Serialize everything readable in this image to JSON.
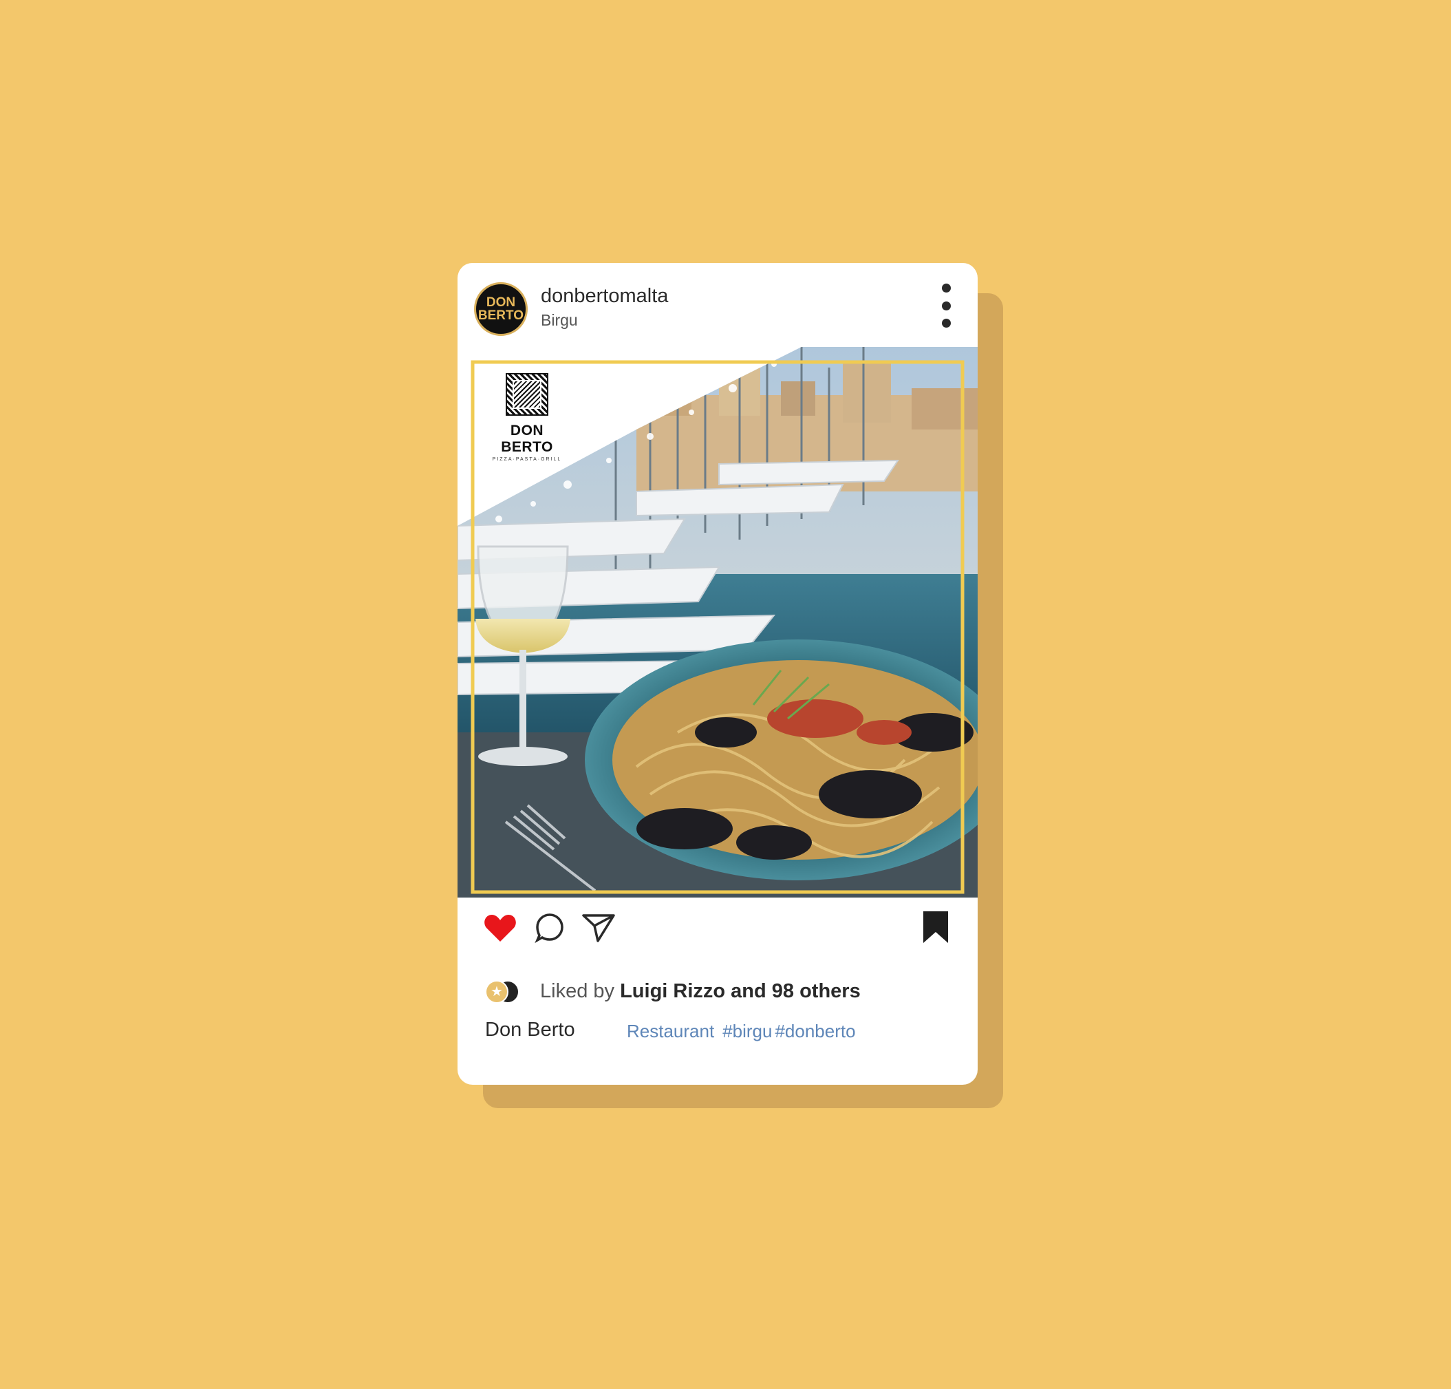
{
  "post": {
    "username": "donbertomalta",
    "location": "Birgu",
    "avatar_text": [
      "DON",
      "BERTO"
    ],
    "brand_overlay": {
      "name": "DON BERTO",
      "tagline": "PIZZA·PASTA·GRILL"
    },
    "liked_by_prefix": "Liked by",
    "liked_by_name": "Luigi Rizzo and 98 others",
    "caption_user": "Don Berto",
    "tags": [
      "Restaurant",
      "#birgu",
      "#donberto"
    ]
  },
  "colors": {
    "background": "#F3C76B",
    "card": "#FFFFFF",
    "shadow": "#D3A75A",
    "frame": "#F0CB52",
    "heart": "#E8161B",
    "tag_link": "#5E86B8"
  },
  "icons": {
    "like": "heart-icon",
    "comment": "comment-icon",
    "share": "send-icon",
    "save": "bookmark-icon",
    "menu": "more-vertical-icon"
  }
}
